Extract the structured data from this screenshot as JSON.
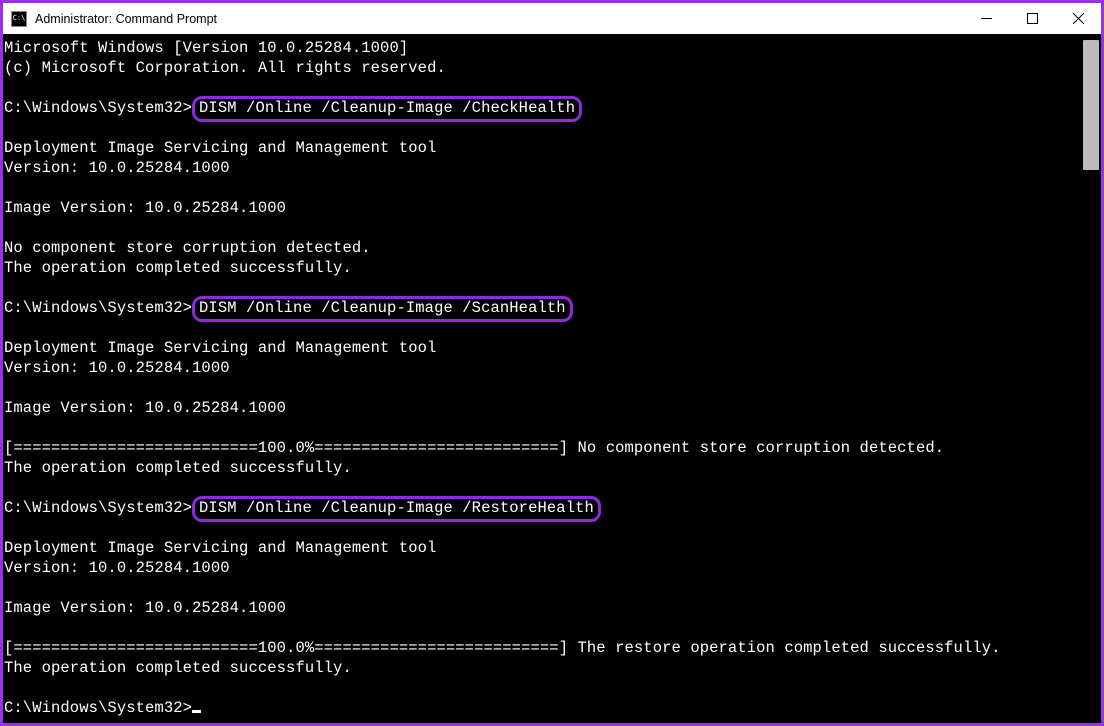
{
  "titlebar": {
    "icon_label": "C:\\",
    "title": "Administrator: Command Prompt"
  },
  "terminal": {
    "header_line1": "Microsoft Windows [Version 10.0.25284.1000]",
    "header_line2": "(c) Microsoft Corporation. All rights reserved.",
    "prompt1_path": "C:\\Windows\\System32>",
    "cmd1": "DISM /Online /Cleanup-Image /CheckHealth",
    "dism_tool": "Deployment Image Servicing and Management tool",
    "dism_version": "Version: 10.0.25284.1000",
    "image_version": "Image Version: 10.0.25284.1000",
    "result1_line1": "No component store corruption detected.",
    "result1_line2": "The operation completed successfully.",
    "prompt2_path": "C:\\Windows\\System32>",
    "cmd2": "DISM /Online /Cleanup-Image /ScanHealth",
    "progress_bar": "[==========================100.0%==========================]",
    "result2_after": " No component store corruption detected.",
    "result2_line2": "The operation completed successfully.",
    "prompt3_path": "C:\\Windows\\System32>",
    "cmd3": "DISM /Online /Cleanup-Image /RestoreHealth",
    "result3_after": " The restore operation completed successfully.",
    "result3_line2": "The operation completed successfully.",
    "final_prompt": "C:\\Windows\\System32>"
  }
}
